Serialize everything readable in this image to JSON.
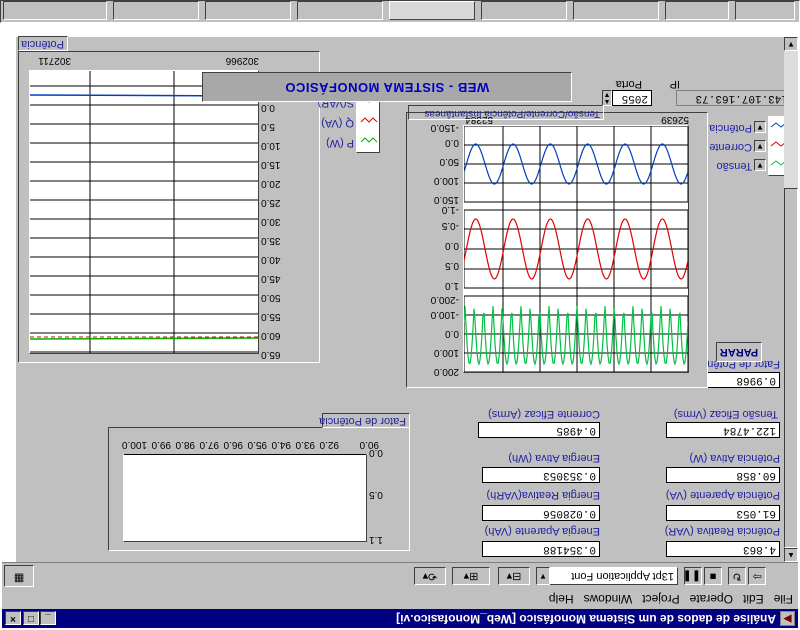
{
  "window": {
    "title": "Análise de dados de um Sistema Monofásico  [Web_Monofasico.vi]"
  },
  "menu": [
    "File",
    "Edit",
    "Operate",
    "Project",
    "Windows",
    "Help"
  ],
  "toolbar": {
    "font": "13pt Application Font"
  },
  "indicators": {
    "potencia_reativa": {
      "label": "Potência Reativa (VAR)",
      "value": "4.863"
    },
    "potencia_aparente": {
      "label": "Potência Aparente (VA)",
      "value": "61.053"
    },
    "potencia_ativa": {
      "label": "Potência Ativa (W)",
      "value": "60.858"
    },
    "tensao_eficaz": {
      "label": "Tensão Eficaz (Vrms)",
      "value": "122.4784"
    },
    "energia_aparente": {
      "label": "Energia Aparente (VAh)",
      "value": "0.354188"
    },
    "energia_reativa": {
      "label": "Energia Reativa(VARh)",
      "value": "0.028056"
    },
    "energia_ativa": {
      "label": "Energia Ativa (Wh)",
      "value": "0.353053"
    },
    "corrente_eficaz": {
      "label": "Corrente Eficaz (Arms)",
      "value": "0.4985"
    },
    "fator_potencia": {
      "label": "Fator de Potência",
      "value": "0.9968"
    }
  },
  "fp_chart": {
    "label": "Fator de Potência",
    "x_ticks": [
      "90.0",
      "92.0",
      "93.0",
      "94.0",
      "95.0",
      "96.0",
      "97.0",
      "98.0",
      "99.0",
      "100.0"
    ],
    "y_ticks": [
      "0.0",
      "0.5",
      "1.1"
    ]
  },
  "power_chart": {
    "label": "Potência",
    "x_start": "302711",
    "x_end": "302966",
    "y_ticks": [
      "0.0",
      "5.0",
      "10.0",
      "15.0",
      "20.0",
      "25.0",
      "30.0",
      "35.0",
      "40.0",
      "45.0",
      "50.0",
      "55.0",
      "60.0",
      "65.0"
    ],
    "legend": [
      "S(VAR)",
      "Q (VA)",
      "P (W)"
    ]
  },
  "wave_chart": {
    "label": "Tensão/Corrente/Potência Instantâneas",
    "x_start": "52384",
    "x_end": "52639",
    "tension_ticks": [
      "-150.0",
      "0.0",
      "50.0",
      "100.0",
      "150.0"
    ],
    "current_ticks": [
      "-1.0",
      "-0.5",
      "0.0",
      "0.5",
      "1.0"
    ],
    "power_ticks": [
      "-200.0",
      "-100.0",
      "0.0",
      "100.0",
      "200.0"
    ],
    "legend": [
      "Potência",
      "Corrente",
      "Tensão"
    ]
  },
  "banner": "WEB - SISTEMA MONOFÁSICO",
  "network": {
    "port_label": "Porta",
    "port": "2055",
    "ip_label": "IP",
    "ip": "143.107.163.73"
  },
  "buttons": {
    "stop": "PARAR"
  },
  "colors": {
    "title_bg": "#000080",
    "panel": "#c0c0c0",
    "label": "#1e1ea0",
    "tension": "#00c040",
    "current": "#e00000",
    "power": "#0040c0"
  }
}
